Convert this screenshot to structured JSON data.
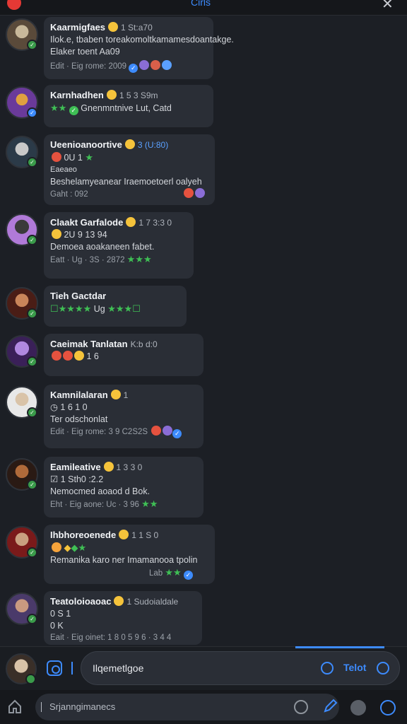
{
  "header": {
    "title": "Cirls",
    "close_icon": "close-icon"
  },
  "messages": [
    {
      "name": "Kaarmigfaes",
      "time": "1 St:a70",
      "lines": [
        "Ilok.e, tbaben toreakomoltkamamesdoantakge.",
        "Elaker toent Aa09"
      ],
      "meta": "Edit · Eig rome: 2009",
      "time_blue": false
    },
    {
      "name": "Karnhadhen",
      "time": "1 5 3 S9m",
      "lines": [
        "Gnenmntnive  Lut, Catd"
      ],
      "meta": "",
      "time_blue": false
    },
    {
      "name": "Ueenioanoortive",
      "time": "3 (U:80)",
      "lines": [
        "0U 1",
        "Eaeaeo",
        "Beshelamyeanear Iraemoetoerl oalyeh"
      ],
      "meta": "Gaht : 092",
      "time_blue": true
    },
    {
      "name": "Claakt Garfalode",
      "time": "1 7 3:3 0",
      "lines": [
        "2U 9 13 94",
        "Demoea aoakaneen fabet."
      ],
      "meta": "Eatt · Ug · 3S · 2872",
      "time_blue": false
    },
    {
      "name": "Tieh Gactdar",
      "time": "",
      "lines": [
        "Ug"
      ],
      "meta": "",
      "time_blue": false
    },
    {
      "name": "Caeimak Tanlatan",
      "time": "K:b d:0",
      "lines": [
        "1 6"
      ],
      "meta": "",
      "time_blue": false
    },
    {
      "name": "Kamnilalaran",
      "time": "1",
      "lines": [
        "1 6 1 0",
        "Ter odschonlat"
      ],
      "meta": "Edit · Eig rome: 3 9 C2S2S",
      "time_blue": false
    },
    {
      "name": "Eamileative",
      "time": "1 3 3 0",
      "lines": [
        "1 Sth0 :2.2",
        "Nemocmed aoaod d Bok."
      ],
      "meta": "Eht · Eig aone: Uc · 3 96",
      "time_blue": false
    },
    {
      "name": "Ihbhoreoenede",
      "time": "1 1 S 0",
      "lines": [
        "Remanika karo ner Imamanooa tpolin"
      ],
      "meta": "Lab",
      "time_blue": false
    },
    {
      "name": "Teatoloioaoac",
      "time": "1 Sudoialdale",
      "lines": [
        "0 S 1",
        "0 K"
      ],
      "meta": "Eait · Eig oinet: 1 8 0  5 9 6 · 3 4 4",
      "time_blue": false
    }
  ],
  "composer": {
    "placeholder": "Ilqemetlgoe",
    "send_label": "Telot"
  },
  "bottom": {
    "search_text": "Srjanngimanecs"
  },
  "colors": {
    "accent": "#3d8bfd",
    "bubble": "#2a2e36",
    "star": "#3fbf55",
    "badge": "#3a9b4a"
  }
}
